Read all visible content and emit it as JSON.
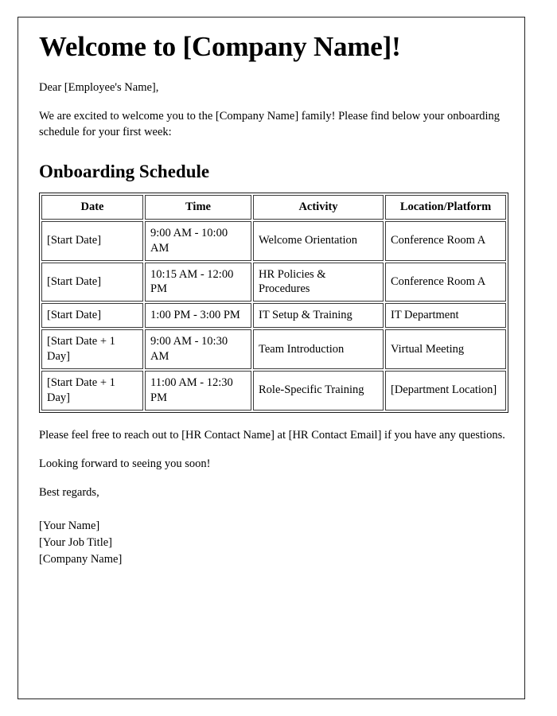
{
  "document": {
    "title": "Welcome to [Company Name]!",
    "salutation": "Dear [Employee's Name],",
    "intro_paragraph": "We are excited to welcome you to the [Company Name] family! Please find below your onboarding schedule for your first week:",
    "section_heading": "Onboarding Schedule",
    "closing_paragraph": "Please feel free to reach out to [HR Contact Name] at [HR Contact Email] if you have any questions.",
    "looking_forward": "Looking forward to seeing you soon!",
    "sign_off": "Best regards,",
    "signature": {
      "name": "[Your Name]",
      "job_title": "[Your Job Title]",
      "company": "[Company Name]"
    }
  },
  "schedule_table": {
    "headers": {
      "date": "Date",
      "time": "Time",
      "activity": "Activity",
      "location": "Location/Platform"
    },
    "rows": [
      {
        "date": "[Start Date]",
        "time": "9:00 AM - 10:00 AM",
        "activity": "Welcome Orientation",
        "location": "Conference Room A"
      },
      {
        "date": "[Start Date]",
        "time": "10:15 AM - 12:00 PM",
        "activity": "HR Policies & Procedures",
        "location": "Conference Room A"
      },
      {
        "date": "[Start Date]",
        "time": "1:00 PM - 3:00 PM",
        "activity": "IT Setup & Training",
        "location": "IT Department"
      },
      {
        "date": "[Start Date + 1 Day]",
        "time": "9:00 AM - 10:30 AM",
        "activity": "Team Introduction",
        "location": "Virtual Meeting"
      },
      {
        "date": "[Start Date + 1 Day]",
        "time": "11:00 AM - 12:30 PM",
        "activity": "Role-Specific Training",
        "location": "[Department Location]"
      }
    ]
  },
  "colors": {
    "page_border": "#222222",
    "table_border": "#1c1c1c",
    "cell_border": "#3a3a3a",
    "text": "#000000",
    "background": "#ffffff"
  }
}
